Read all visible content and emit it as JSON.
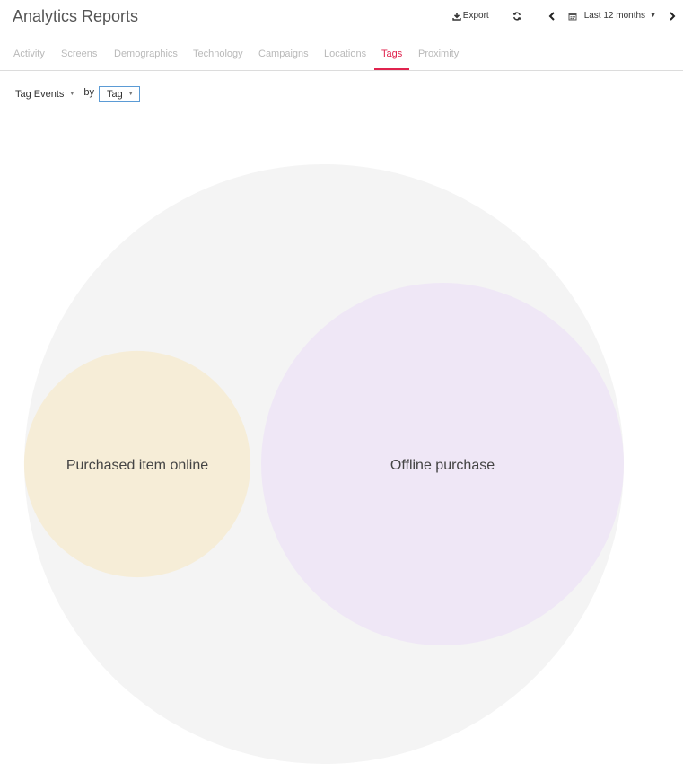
{
  "header": {
    "title": "Analytics Reports",
    "export_label": "Export",
    "date_range_label": "Last 12 months",
    "icons": {
      "export": "download-icon",
      "refresh": "refresh-icon",
      "prev": "chevron-left-icon",
      "calendar": "calendar-icon",
      "next": "chevron-right-icon"
    }
  },
  "tabs": [
    {
      "label": "Activity",
      "active": false
    },
    {
      "label": "Screens",
      "active": false
    },
    {
      "label": "Demographics",
      "active": false
    },
    {
      "label": "Technology",
      "active": false
    },
    {
      "label": "Campaigns",
      "active": false
    },
    {
      "label": "Locations",
      "active": false
    },
    {
      "label": "Tags",
      "active": true
    },
    {
      "label": "Proximity",
      "active": false
    }
  ],
  "filters": {
    "metric_value": "Tag Events",
    "by_label": "by",
    "group_value": "Tag"
  },
  "colors": {
    "accent": "#e0234e",
    "outer_bubble": "#f4f4f4",
    "online_bubble": "#f6edd7",
    "offline_bubble": "#efe7f6"
  },
  "chart_data": {
    "type": "bubble",
    "series": [
      {
        "name": "Purchased item online",
        "relative_size": 0.39,
        "color": "#f6edd7"
      },
      {
        "name": "Offline purchase",
        "relative_size": 1.0,
        "color": "#efe7f6"
      }
    ]
  }
}
